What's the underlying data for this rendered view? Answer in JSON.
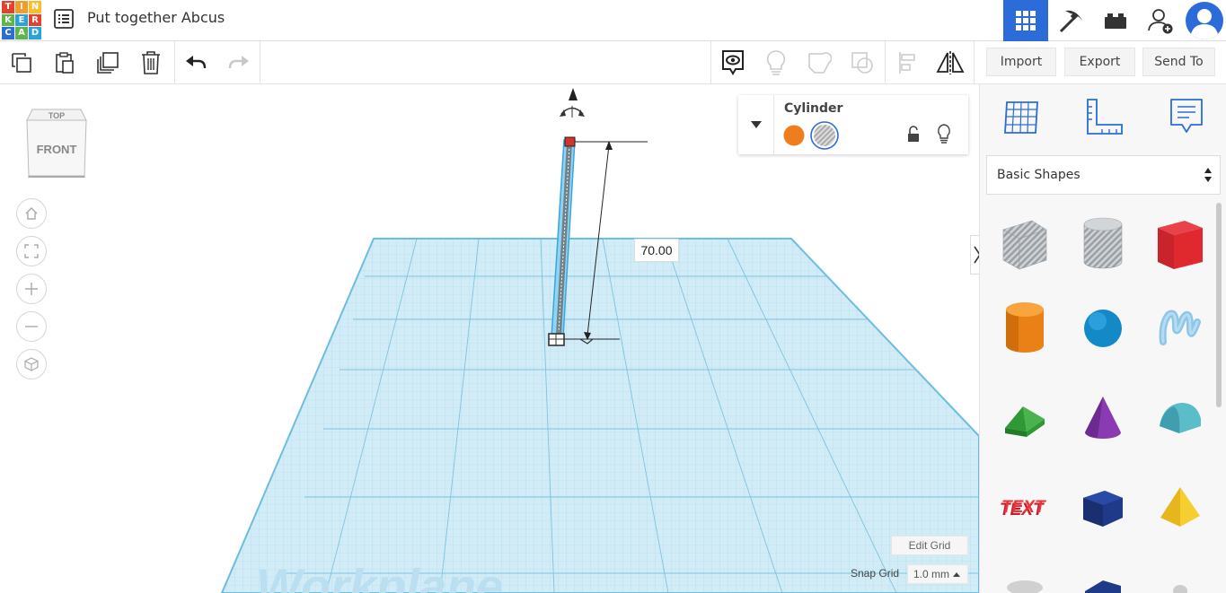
{
  "logo": {
    "letters": [
      "T",
      "I",
      "N",
      "K",
      "E",
      "R",
      "C",
      "A",
      "D"
    ],
    "colors": [
      "#e2422f",
      "#f49c2b",
      "#f5bf2f",
      "#5fb54a",
      "#2ba3d8",
      "#e2422f",
      "#2b6cd8",
      "#5fb54a",
      "#2ba3d8"
    ]
  },
  "header": {
    "title": "Put together Abcus",
    "menu_icon": "list-icon"
  },
  "topright": {
    "icons": [
      "grid-view-icon",
      "pickaxe-icon",
      "bricks-icon",
      "add-user-icon",
      "avatar"
    ],
    "accent": "#2b6cd8"
  },
  "toolbar": {
    "import_label": "Import",
    "export_label": "Export",
    "sendto_label": "Send To"
  },
  "viewcube": {
    "top_label": "TOP",
    "front_label": "FRONT"
  },
  "dimension": {
    "value": "70.00"
  },
  "workplane_label": "Workplane",
  "properties": {
    "shape_name": "Cylinder",
    "solid_color": "#f07d1d"
  },
  "grid": {
    "edit_label": "Edit Grid",
    "snap_label": "Snap Grid",
    "snap_value": "1.0 mm"
  },
  "sidebar": {
    "category": "Basic Shapes",
    "shapes": [
      "Box Hole",
      "Cylinder Hole",
      "Box",
      "Cylinder",
      "Sphere",
      "Scribble",
      "Roof",
      "Cone",
      "Round Roof",
      "Text",
      "Polygon",
      "Pyramid"
    ]
  }
}
